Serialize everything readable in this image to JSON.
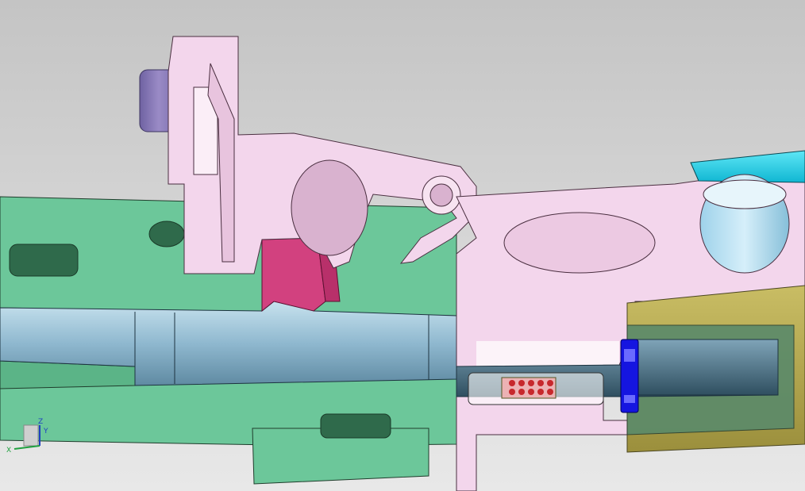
{
  "viewport": {
    "background_top": "#c6c6c6",
    "background_bottom": "#e6e6e6"
  },
  "model": {
    "parts": [
      {
        "name": "green-housing",
        "color": "#6cc79a"
      },
      {
        "name": "light-blue-shaft",
        "color": "#a9cfe0"
      },
      {
        "name": "pink-lever",
        "color": "#f3d6ec"
      },
      {
        "name": "purple-pin",
        "color": "#8877b5"
      },
      {
        "name": "magenta-insert",
        "color": "#d2417f"
      },
      {
        "name": "cyan-arm",
        "color": "#2bd8ef"
      },
      {
        "name": "olive-collar",
        "color": "#b9ac55"
      },
      {
        "name": "blue-clip",
        "color": "#1515e0"
      },
      {
        "name": "red-spring-element",
        "color": "#c7282c"
      }
    ]
  },
  "triad": {
    "axis_z": "Z",
    "axis_y": "Y",
    "axis_x": "X",
    "color_z": "#2040c0",
    "color_x": "#20a040"
  }
}
